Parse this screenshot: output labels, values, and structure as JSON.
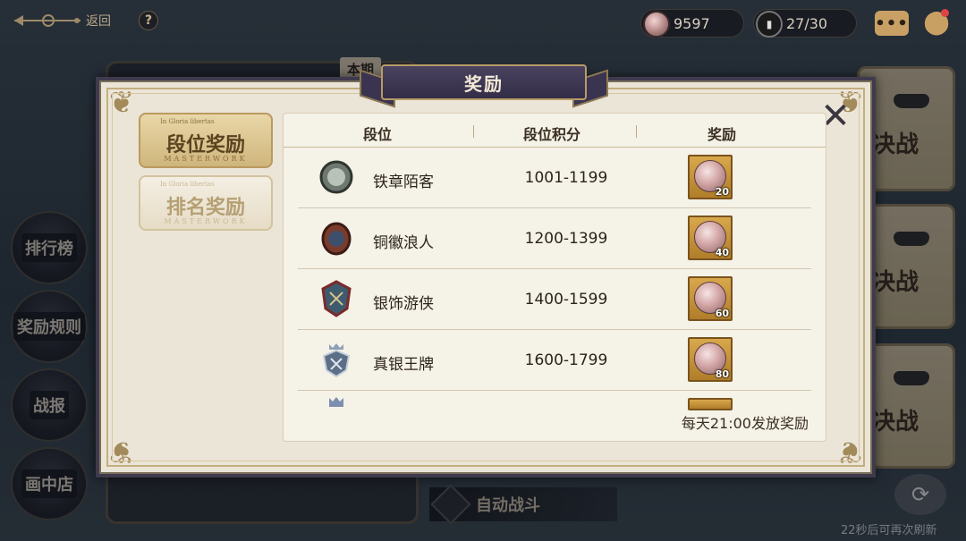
{
  "topbar": {
    "back_label": "返回",
    "help_label": "?",
    "coins": "9597",
    "tickets": "27/30",
    "chat_label": "•••"
  },
  "sidebar": {
    "items": [
      {
        "label": "排行榜"
      },
      {
        "label": "奖励规则"
      },
      {
        "label": "战报"
      },
      {
        "label": "画中店"
      }
    ]
  },
  "battle_cards": [
    {
      "label": "决战"
    },
    {
      "label": "决战"
    },
    {
      "label": "决战"
    }
  ],
  "under_tab": "本期",
  "auto_battle_label": "自动战斗",
  "refresh_note": "22秒后可再次刷新",
  "modal": {
    "title": "奖励",
    "close_icon": "close-x-icon",
    "tabs": [
      {
        "label": "段位奖励",
        "sub": "MASTERWORK",
        "tiny": "In Gloria libertas",
        "active": true
      },
      {
        "label": "排名奖励",
        "sub": "MASTERWORK",
        "tiny": "In Gloria libertas",
        "active": false
      }
    ],
    "table": {
      "headers": [
        "段位",
        "段位积分",
        "奖励"
      ],
      "rows": [
        {
          "name": "铁章陌客",
          "range": "1001-1199",
          "reward_qty": "20",
          "badge": "iron-medal-icon",
          "badge_color": "#5f6a5e"
        },
        {
          "name": "铜徽浪人",
          "range": "1200-1399",
          "reward_qty": "40",
          "badge": "bronze-emblem-icon",
          "badge_color": "#7a3b2c"
        },
        {
          "name": "银饰游侠",
          "range": "1400-1599",
          "reward_qty": "60",
          "badge": "silver-crest-icon",
          "badge_color": "#3e5a6e"
        },
        {
          "name": "真银王牌",
          "range": "1600-1799",
          "reward_qty": "80",
          "badge": "true-silver-crown-icon",
          "badge_color": "#5c6f86"
        }
      ]
    },
    "footer": "每天21:00发放奖励"
  },
  "colors": {
    "accent_gold": "#c9a064",
    "modal_bg": "#ebe5d8",
    "banner": "#3f3a5a"
  }
}
